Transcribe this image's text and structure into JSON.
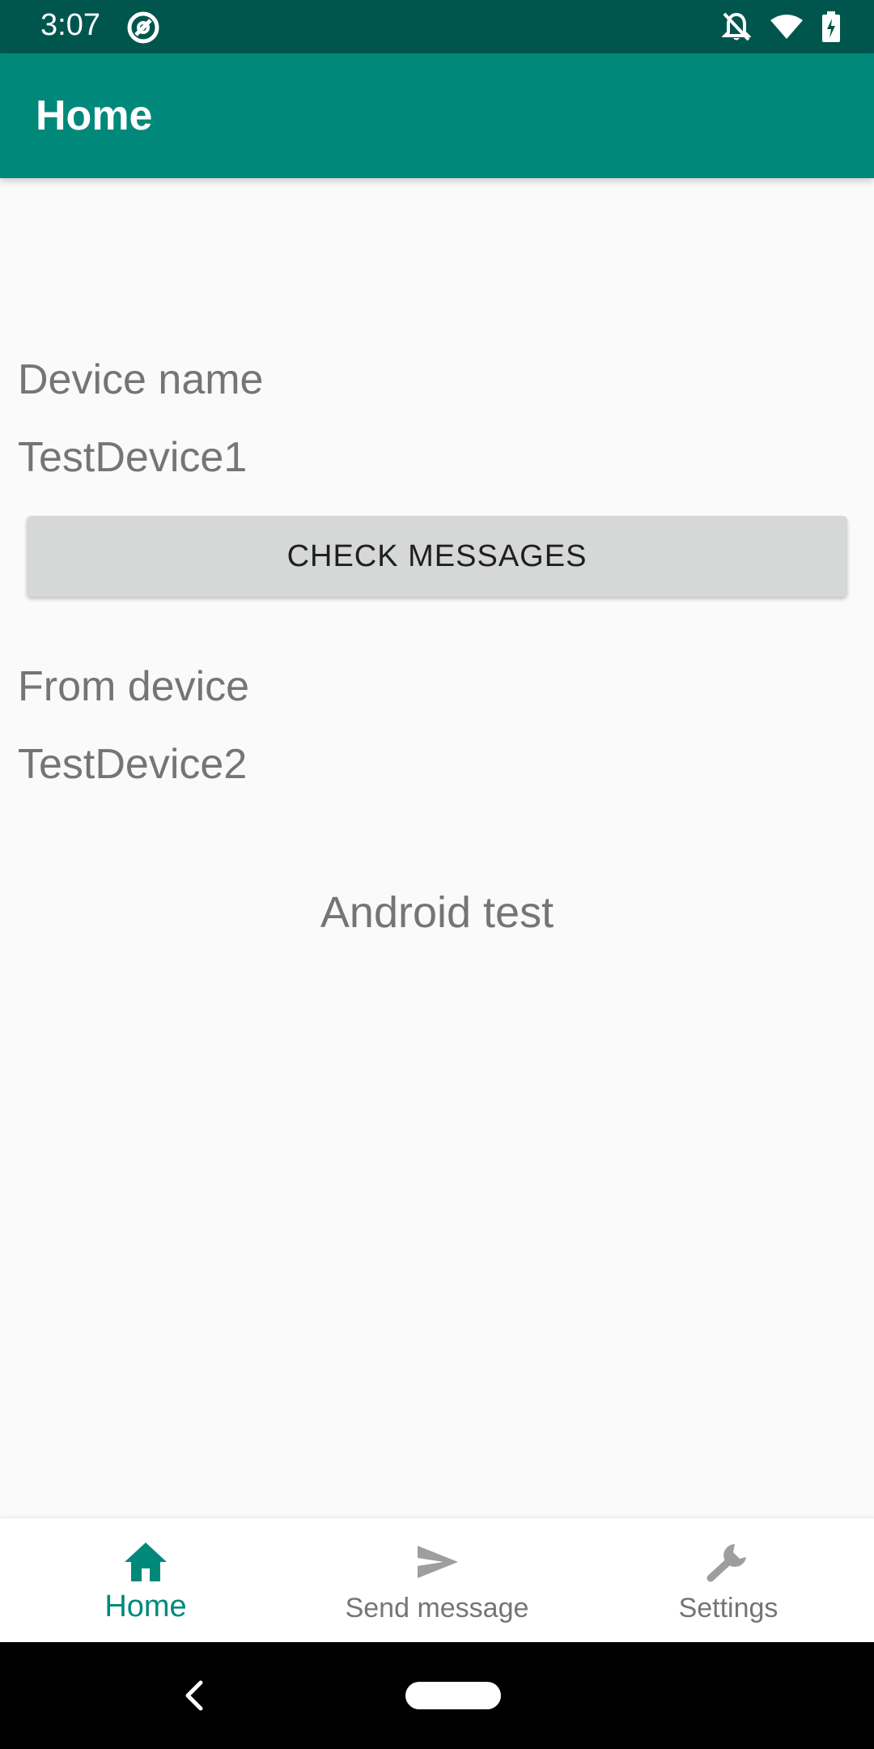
{
  "status_bar": {
    "time": "3:07"
  },
  "app_bar": {
    "title": "Home"
  },
  "content": {
    "device_name_label": "Device name",
    "device_name_value": "TestDevice1",
    "check_button_label": "CHECK MESSAGES",
    "from_device_label": "From device",
    "from_device_value": "TestDevice2",
    "message_text": "Android test"
  },
  "bottom_nav": {
    "items": [
      {
        "label": "Home",
        "icon": "home-icon",
        "active": true
      },
      {
        "label": "Send message",
        "icon": "send-icon",
        "active": false
      },
      {
        "label": "Settings",
        "icon": "wrench-icon",
        "active": false
      }
    ]
  },
  "colors": {
    "primary": "#00897B",
    "primary_dark": "#00564D",
    "background": "#FAFAFA",
    "inactive": "#9E9E9E"
  }
}
